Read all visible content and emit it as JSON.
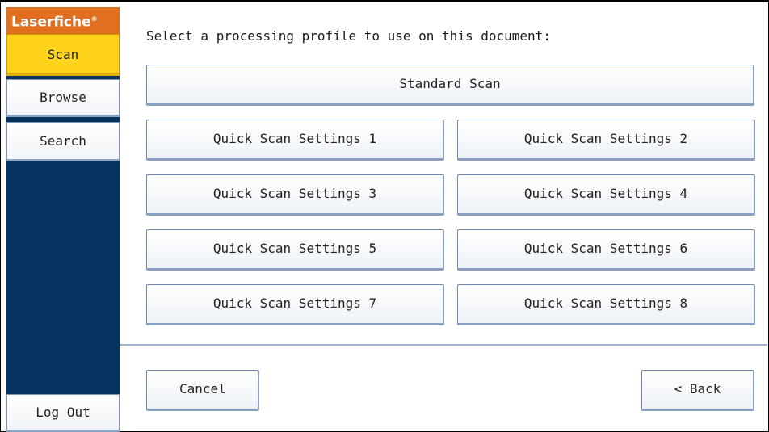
{
  "sidebar": {
    "logo": "Laserfiche",
    "logo_mark": "®",
    "items": [
      {
        "label": "Scan"
      },
      {
        "label": "Browse"
      },
      {
        "label": "Search"
      }
    ],
    "logout": "Log Out"
  },
  "main": {
    "prompt": "Select a processing profile to use on this document:",
    "standard": "Standard Scan",
    "profiles": [
      "Quick Scan Settings 1",
      "Quick Scan Settings 2",
      "Quick Scan Settings 3",
      "Quick Scan Settings 4",
      "Quick Scan Settings 5",
      "Quick Scan Settings 6",
      "Quick Scan Settings 7",
      "Quick Scan Settings 8"
    ],
    "cancel": "Cancel",
    "back": "< Back"
  },
  "colors": {
    "accent_orange": "#e07020",
    "selected_yellow": "#ffd21c",
    "sidebar_navy": "#06335f"
  }
}
